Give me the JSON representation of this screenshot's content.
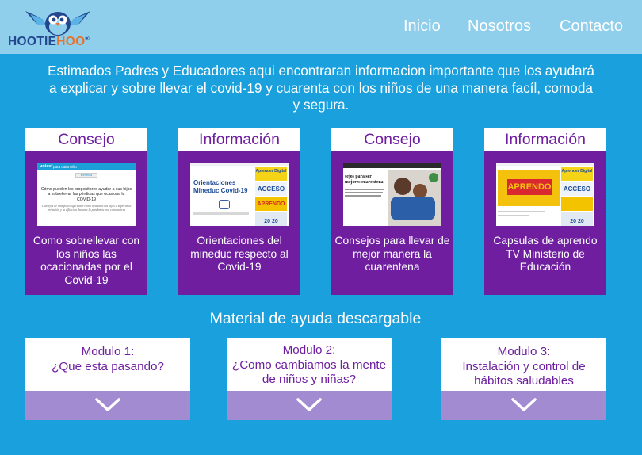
{
  "brand": {
    "logo_text_a": "HOOTIE",
    "logo_text_b": "HOO",
    "logo_mark": "®"
  },
  "nav": {
    "items": [
      "Inicio",
      "Nosotros",
      "Contacto"
    ]
  },
  "intro": {
    "text": "Estimados Padres y Educadores aqui encontraran informacion importante que los ayudará a explicar y sobre llevar el covid-19 y cuarenta con los niños de una manera facíl, comoda y segura."
  },
  "cards": [
    {
      "title": "Consejo",
      "text": "Como sobrellevar con los niños las ocacionadas por el Covid-19",
      "thumb": {
        "brand": "unicef",
        "tag": "para cada niño",
        "button": "leer más",
        "headline": "Cómo pueden los progenitores ayudar a sus hijos a sobrellevar las pérdidas que ocasiona la COVID-19",
        "sub": "Consejos de una psicóloga sobre cómo ayudar a tus hijos a superar la privación y la aflicción durante la pandemia por coronavirus"
      }
    },
    {
      "title": "Información",
      "text": "Orientaciones del mineduc respecto al Covid-19",
      "thumb": {
        "headline": "Orientaciones Mineduc Covid-19",
        "side1": "Aprender Digital",
        "side2": "ACCESO",
        "side3": "APRENDO",
        "side4": "20 20"
      }
    },
    {
      "title": "Consejo",
      "text": "Consejos para llevar de mejor manera la cuarentena",
      "thumb": {
        "headline": "sejos para ser mejores cuarentena"
      }
    },
    {
      "title": "Información",
      "text": "Capsulas de aprendo TV Ministerio de Educación",
      "thumb": {
        "headline": "APRENDO",
        "side1": "Aprender Digital",
        "side2": "ACCESO",
        "side4": "20 20"
      }
    }
  ],
  "downloads": {
    "title": "Material de ayuda descargable",
    "modules": [
      {
        "line1": "Modulo 1:",
        "line2": "¿Que esta pasando?",
        "line3": ""
      },
      {
        "line1": "Modulo 2:",
        "line2": "¿Como cambiamos la mente",
        "line3": "de niños y niñas?"
      },
      {
        "line1": "Modulo 3:",
        "line2": "Instalación y control de",
        "line3": "hábitos saludables"
      }
    ]
  },
  "colors": {
    "background": "#1aa0dd",
    "header": "#8fcfec",
    "card": "#6e1e9f",
    "module_footer": "#a28bd0",
    "brand_blue": "#23478f",
    "brand_orange": "#e5732f"
  },
  "icons": {
    "logo": "owl-logo-icon",
    "module_toggle": "chevron-down-icon"
  }
}
